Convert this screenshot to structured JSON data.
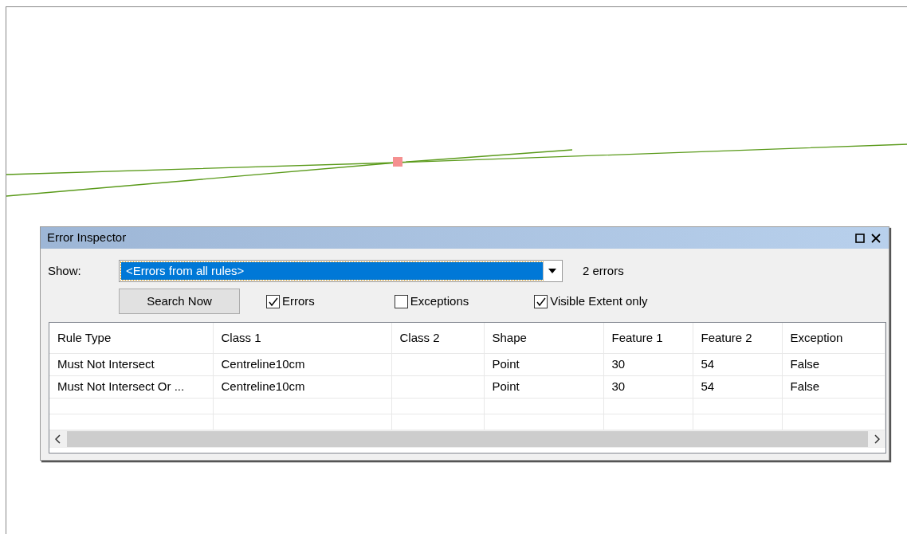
{
  "panel": {
    "title": "Error Inspector",
    "show_label": "Show:",
    "show_value": "<Errors from all rules>",
    "count": "2 errors",
    "search_button": "Search Now",
    "filters": [
      {
        "label": "Errors",
        "checked": true
      },
      {
        "label": "Exceptions",
        "checked": false
      },
      {
        "label": "Visible Extent only",
        "checked": true
      }
    ]
  },
  "table": {
    "columns": [
      "Rule Type",
      "Class 1",
      "Class 2",
      "Shape",
      "Feature 1",
      "Feature 2",
      "Exception"
    ],
    "rows": [
      [
        "Must Not Intersect",
        "Centreline10cm",
        "",
        "Point",
        "30",
        "54",
        "False"
      ],
      [
        "Must Not Intersect Or ...",
        "Centreline10cm",
        "",
        "Point",
        "30",
        "54",
        "False"
      ]
    ]
  }
}
